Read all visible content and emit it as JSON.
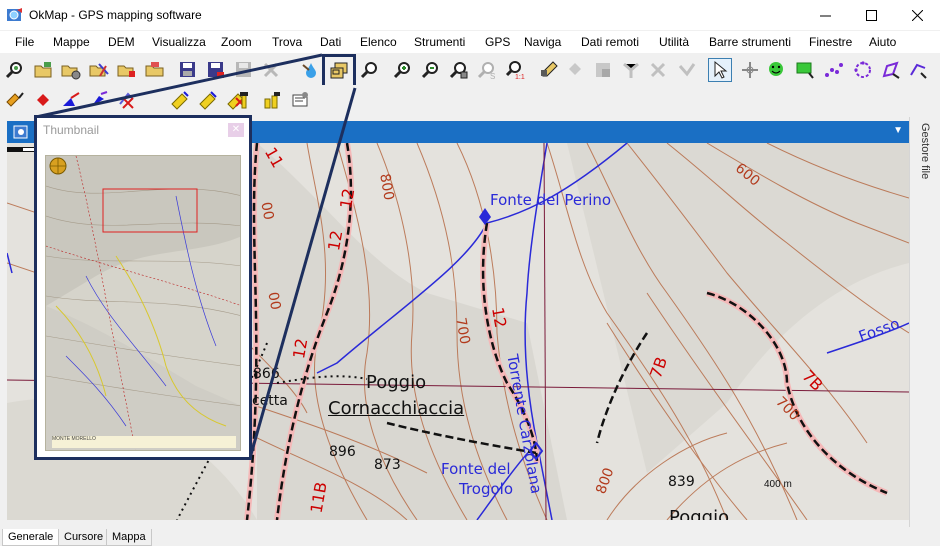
{
  "window": {
    "title": "OkMap - GPS mapping software"
  },
  "menu": [
    "File",
    "Mappe",
    "DEM",
    "Visualizza",
    "Zoom",
    "Trova",
    "Dati",
    "Elenco",
    "Strumenti",
    "GPS",
    "Naviga",
    "Dati remoti",
    "Utilità",
    "Barre strumenti",
    "Finestre",
    "Aiuto"
  ],
  "toolbar_icons": {
    "row1": [
      "find-map-icon",
      "open-folder-icon",
      "open-folder-settings-icon",
      "folder-tools-icon",
      "folder-delete-icon",
      "folder-open-icon",
      "save-icon",
      "save-as-icon",
      "save-disabled-icon",
      "print-disabled-icon",
      "drop-icon",
      "thumbnail-icon",
      "search-icon",
      "zoom-in-icon",
      "zoom-out-icon",
      "zoom-fit-icon",
      "zoom-disabled-icon",
      "zoom-1-1-icon",
      "edit-icon",
      "waypoint-disabled-icon",
      "route-disabled-icon",
      "track-disabled-icon",
      "marker-disabled-icon",
      "pointer-icon",
      "crosshair-icon",
      "smiley-icon",
      "note-icon",
      "dots-icon",
      "polygon-icon",
      "draw-icon",
      "link-icon"
    ],
    "row2": [
      "pencil-icon",
      "diamond-icon",
      "triangle-icon",
      "brush-icon",
      "erase-icon",
      "ruler-icon",
      "ruler-edit-icon",
      "ruler-delete-icon",
      "flag-icon",
      "flags-icon",
      "properties-icon"
    ]
  },
  "thumbnail": {
    "title": "Thumbnail",
    "caption": "MONTE MORELLO"
  },
  "side_panel": {
    "label": "Gestore file"
  },
  "map": {
    "labels": {
      "fonte_perino": "Fonte del Perino",
      "poggio": "Poggio",
      "cornacchiaccia": "Cornacchiaccia",
      "fonte_trogolo_1": "Fonte del",
      "fonte_trogolo_2": "Trogolo",
      "torrente": "Torrente Carzolana",
      "fosso": "Fosso",
      "poggio_bottom": "Poggio",
      "cetta": "cetta",
      "spot_866": "866",
      "spot_896": "896",
      "spot_873": "873",
      "spot_839": "839",
      "contour_600": "600",
      "contour_700a": "700",
      "contour_700b": "700",
      "contour_800a": "800",
      "contour_800b": "800",
      "contour_00a": "00",
      "contour_00b": "00",
      "trail_12a": "12",
      "trail_12b": "12",
      "trail_12c": "12",
      "trail_12d": "12",
      "trail_11": "11",
      "trail_11b": "11B",
      "trail_7b_a": "7B",
      "trail_7b_b": "7B"
    },
    "scale_label": "400 m"
  },
  "bottom_tabs": [
    "Generale",
    "Cursore",
    "Mappa"
  ],
  "colors": {
    "highlight_border": "#1d2f5e",
    "doc_tab": "#1a6fc4",
    "contour": "#b8714e",
    "trail": "#c93a3a",
    "water": "#2a2ad8"
  }
}
